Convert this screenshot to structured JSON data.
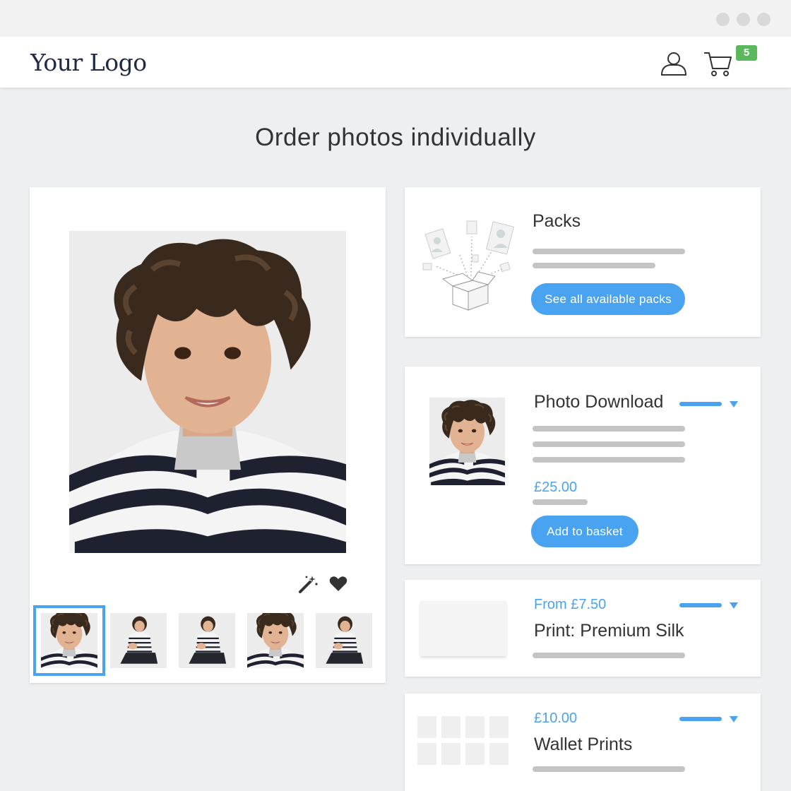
{
  "header": {
    "logo": "Your Logo",
    "cart_count": "5"
  },
  "page": {
    "title": "Order photos individually"
  },
  "photo_viewer": {
    "icons": [
      "magic-wand-icon",
      "heart-icon"
    ],
    "thumbnails": [
      "thumb-1",
      "thumb-2",
      "thumb-3",
      "thumb-4",
      "thumb-5"
    ],
    "selected_thumbnail": 0
  },
  "products": {
    "packs": {
      "title": "Packs",
      "button": "See all available packs"
    },
    "photo_download": {
      "title": "Photo Download",
      "price": "£25.00",
      "button": "Add to basket"
    },
    "print_premium": {
      "price": "From £7.50",
      "title": "Print: Premium Silk"
    },
    "wallet_prints": {
      "price": "£10.00",
      "title": "Wallet Prints"
    }
  },
  "colors": {
    "accent": "#4aa3f0",
    "badge": "#5cb85c",
    "logo": "#1f2a44"
  }
}
